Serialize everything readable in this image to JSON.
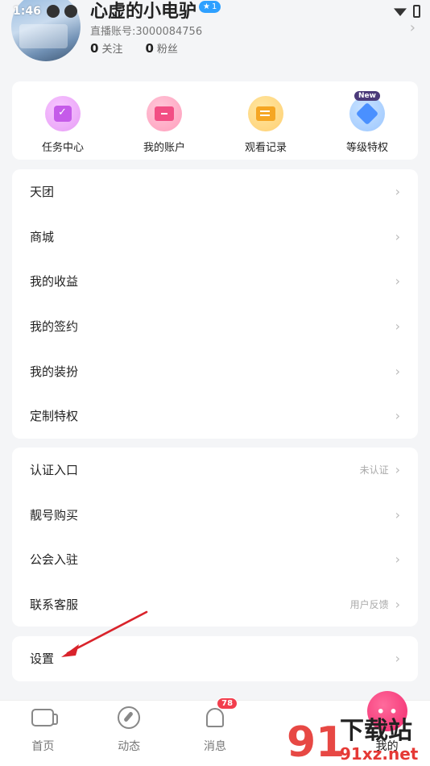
{
  "status_bar": {
    "time": "1:46"
  },
  "profile": {
    "username": "心虚的小电驴",
    "level_badge": "1",
    "account_id": "直播账号:3000084756",
    "following_count": "0",
    "following_label": "关注",
    "followers_count": "0",
    "followers_label": "粉丝"
  },
  "quick_actions": [
    {
      "label": "任务中心",
      "icon": "task-calendar-icon"
    },
    {
      "label": "我的账户",
      "icon": "wallet-folder-icon"
    },
    {
      "label": "观看记录",
      "icon": "history-icon"
    },
    {
      "label": "等级特权",
      "icon": "level-gem-icon",
      "tag": "New"
    }
  ],
  "menu_group_1": [
    {
      "label": "天团"
    },
    {
      "label": "商城"
    },
    {
      "label": "我的收益"
    },
    {
      "label": "我的签约"
    },
    {
      "label": "我的装扮"
    },
    {
      "label": "定制特权"
    }
  ],
  "menu_group_2": [
    {
      "label": "认证入口",
      "sub": "未认证"
    },
    {
      "label": "靓号购买"
    },
    {
      "label": "公会入驻"
    },
    {
      "label": "联系客服",
      "sub": "用户反馈"
    }
  ],
  "menu_group_3": [
    {
      "label": "设置"
    }
  ],
  "bottom_nav": [
    {
      "label": "首页",
      "icon": "video-home-icon"
    },
    {
      "label": "动态",
      "icon": "compass-icon"
    },
    {
      "label": "消息",
      "icon": "bell-icon",
      "badge": "78"
    },
    {
      "label": "",
      "icon": ""
    },
    {
      "label": "我的",
      "icon": "me-face-icon"
    }
  ],
  "watermark": {
    "text": "下载站",
    "site": "91xz.net",
    "logo": "91"
  },
  "colors": {
    "accent": "#f2286d",
    "badge": "#f23e4d",
    "level_badge": "#2ea0ff",
    "annotation_arrow": "#d9232b"
  }
}
